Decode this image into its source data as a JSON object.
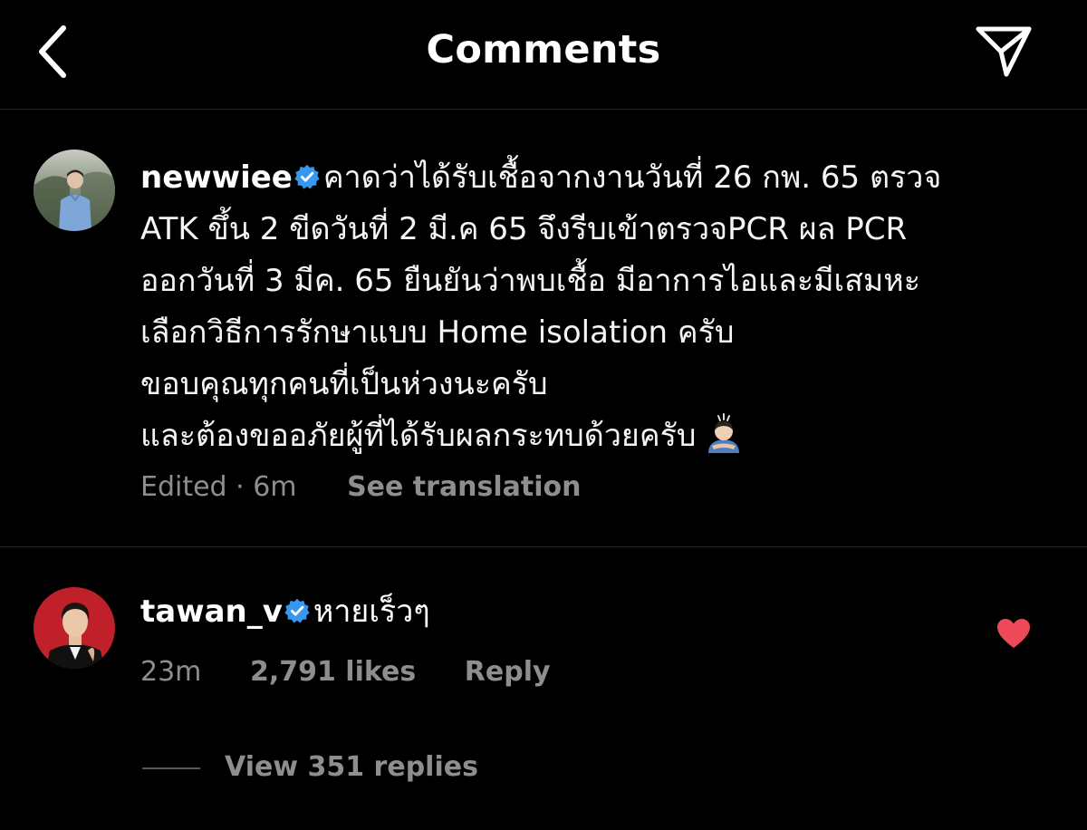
{
  "header": {
    "title": "Comments",
    "back_icon": "chevron-left-icon",
    "share_icon": "send-icon"
  },
  "caption": {
    "username": "newwiee",
    "verified": true,
    "lines": [
      "คาดว่าได้รับเชื้อจากงานวันที่ 26 กพ. 65  ตรวจ",
      "ATK ขึ้น 2 ขีดวันที่ 2 มี.ค 65 จึงรีบเข้าตรวจPCR ผล PCR",
      "ออกวันที่ 3 มีค. 65 ยืนยันว่าพบเชื้อ มีอาการไอและมีเสมหะ",
      "เลือกวิธีการรักษาแบบ Home isolation ครับ",
      "ขอบคุณทุกคนที่เป็นห่วงนะครับ",
      "และต้องขออภัยผู้ที่ได้รับผลกระทบด้วยครับ"
    ],
    "emoji": "person-bowing-emoji",
    "meta": "Edited · 6m",
    "see_translation": "See translation"
  },
  "comment": {
    "username": "tawan_v",
    "verified": true,
    "text": "หายเร็วๆ",
    "time": "23m",
    "likes": "2,791 likes",
    "reply": "Reply",
    "liked": true,
    "view_replies": "View 351 replies"
  },
  "colors": {
    "background": "#000000",
    "text": "#ffffff",
    "muted": "#8e8e8e",
    "verified": "#3897f0",
    "heart": "#ed4956",
    "divider": "#262626"
  }
}
